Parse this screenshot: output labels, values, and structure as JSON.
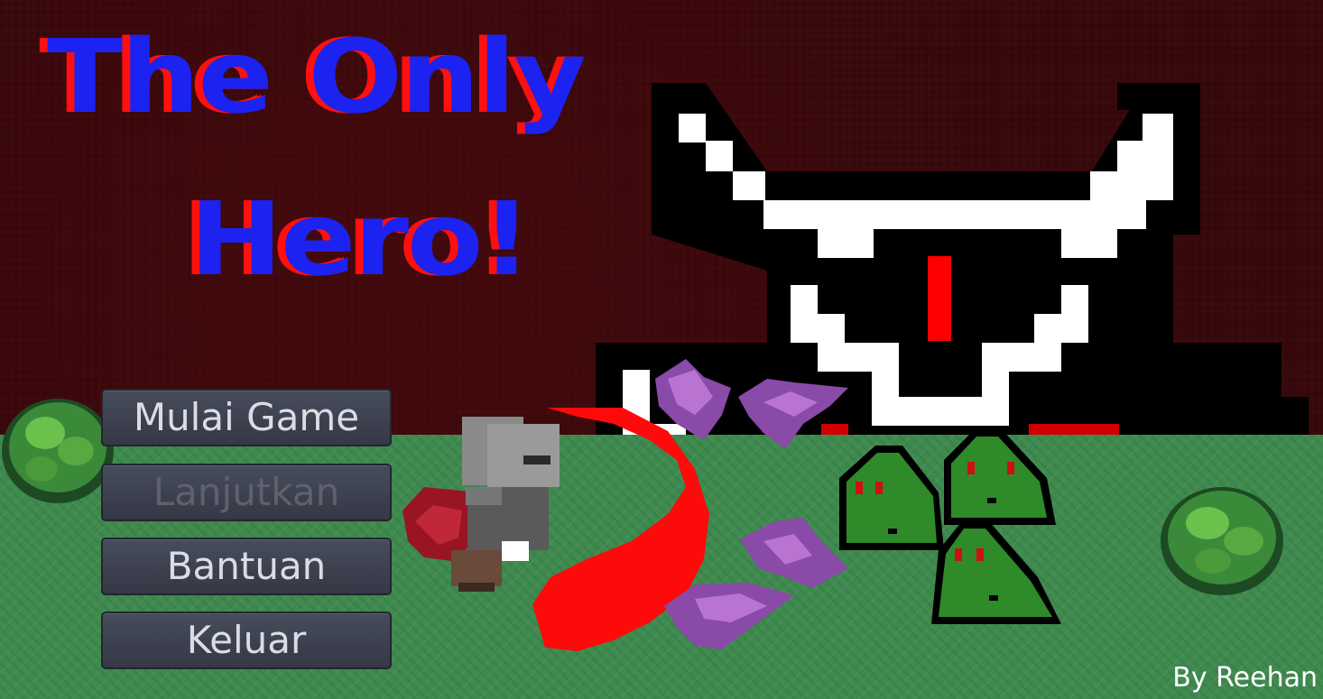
{
  "game": {
    "title_line_1": "The Only",
    "title_line_2": "Hero!",
    "credit": "By Reehan"
  },
  "menu": {
    "items": [
      {
        "label": "Mulai Game",
        "enabled": true
      },
      {
        "label": "Lanjutkan",
        "enabled": false
      },
      {
        "label": "Bantuan",
        "enabled": true
      },
      {
        "label": "Keluar",
        "enabled": true
      }
    ]
  },
  "colors": {
    "sky": "#3c0a0d",
    "grass": "#3f8a4f",
    "title_fill": "#1c22f0",
    "title_shadow": "#ff1010",
    "slime": "#2f8a2a",
    "bat": "#8a4aa8",
    "boss_eye": "#ff0000"
  }
}
